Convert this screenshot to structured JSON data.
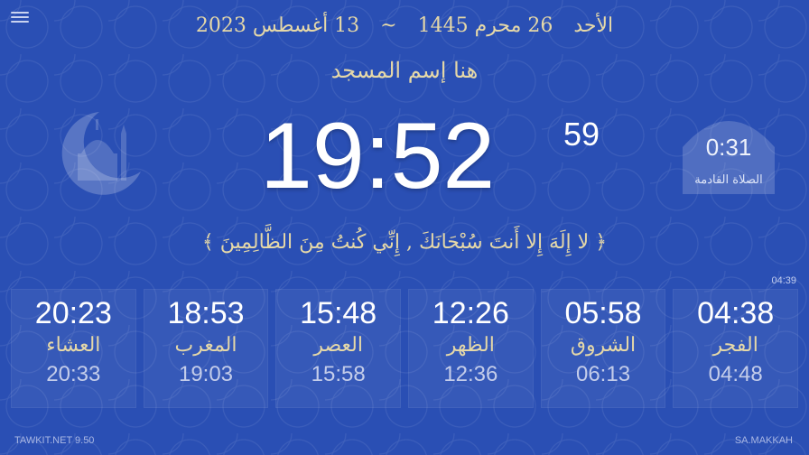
{
  "date": {
    "day_name": "الأحد",
    "hijri": "26 محرم 1445",
    "separator": "~",
    "gregorian": "13 أغسطس 2023"
  },
  "mosque_name": "هنا إسم المسجد",
  "clock": {
    "time": "19:52",
    "seconds": "59"
  },
  "next_prayer": {
    "countdown": "0:31",
    "label": "الصلاة القادمة"
  },
  "dhikr": "﴿ لا إِلَهَ إِلا أَنتَ سُبْحَانَكَ , إِنِّي كُنتُ مِنَ الظَّالِمِينَ ﴾",
  "small_time": "04:39",
  "prayers": [
    {
      "time": "20:23",
      "name": "العشاء",
      "iqama": "20:33"
    },
    {
      "time": "18:53",
      "name": "المغرب",
      "iqama": "19:03"
    },
    {
      "time": "15:48",
      "name": "العصر",
      "iqama": "15:58"
    },
    {
      "time": "12:26",
      "name": "الظهر",
      "iqama": "12:36"
    },
    {
      "time": "05:58",
      "name": "الشروق",
      "iqama": "06:13"
    },
    {
      "time": "04:38",
      "name": "الفجر",
      "iqama": "04:48"
    }
  ],
  "footer": {
    "left": "TAWKIT.NET 9.50",
    "right": "SA.MAKKAH"
  },
  "colors": {
    "background": "#2a4fb4",
    "gold_text": "#e5d8a8",
    "clock_text": "#ffffff"
  }
}
